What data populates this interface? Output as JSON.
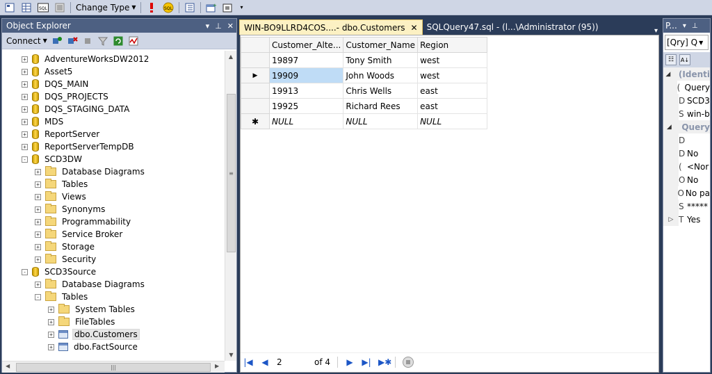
{
  "toolbar": {
    "change_type_label": "Change Type"
  },
  "object_explorer": {
    "title": "Object Explorer",
    "connect_label": "Connect",
    "tree": [
      {
        "label": "AdventureWorksDW2012",
        "level": 0,
        "icon": "database-icon",
        "expander": "+"
      },
      {
        "label": "Asset5",
        "level": 0,
        "icon": "database-icon",
        "expander": "+"
      },
      {
        "label": "DQS_MAIN",
        "level": 0,
        "icon": "database-icon",
        "expander": "+"
      },
      {
        "label": "DQS_PROJECTS",
        "level": 0,
        "icon": "database-icon",
        "expander": "+"
      },
      {
        "label": "DQS_STAGING_DATA",
        "level": 0,
        "icon": "database-icon",
        "expander": "+"
      },
      {
        "label": "MDS",
        "level": 0,
        "icon": "database-icon",
        "expander": "+"
      },
      {
        "label": "ReportServer",
        "level": 0,
        "icon": "database-icon",
        "expander": "+"
      },
      {
        "label": "ReportServerTempDB",
        "level": 0,
        "icon": "database-icon",
        "expander": "+"
      },
      {
        "label": "SCD3DW",
        "level": 0,
        "icon": "database-icon",
        "expander": "-"
      },
      {
        "label": "Database Diagrams",
        "level": 1,
        "icon": "folder-icon",
        "expander": "+"
      },
      {
        "label": "Tables",
        "level": 1,
        "icon": "folder-icon",
        "expander": "+"
      },
      {
        "label": "Views",
        "level": 1,
        "icon": "folder-icon",
        "expander": "+"
      },
      {
        "label": "Synonyms",
        "level": 1,
        "icon": "folder-icon",
        "expander": "+"
      },
      {
        "label": "Programmability",
        "level": 1,
        "icon": "folder-icon",
        "expander": "+"
      },
      {
        "label": "Service Broker",
        "level": 1,
        "icon": "folder-icon",
        "expander": "+"
      },
      {
        "label": "Storage",
        "level": 1,
        "icon": "folder-icon",
        "expander": "+"
      },
      {
        "label": "Security",
        "level": 1,
        "icon": "folder-icon",
        "expander": "+"
      },
      {
        "label": "SCD3Source",
        "level": 0,
        "icon": "database-icon",
        "expander": "-"
      },
      {
        "label": "Database Diagrams",
        "level": 1,
        "icon": "folder-icon",
        "expander": "+"
      },
      {
        "label": "Tables",
        "level": 1,
        "icon": "folder-icon",
        "expander": "-"
      },
      {
        "label": "System Tables",
        "level": 2,
        "icon": "folder-icon",
        "expander": "+"
      },
      {
        "label": "FileTables",
        "level": 2,
        "icon": "folder-icon",
        "expander": "+"
      },
      {
        "label": "dbo.Customers",
        "level": 2,
        "icon": "table-icon",
        "expander": "+",
        "selected": true
      },
      {
        "label": "dbo.FactSource",
        "level": 2,
        "icon": "table-icon",
        "expander": "+"
      }
    ]
  },
  "tabs": [
    {
      "label": "WIN-BO9LLRD4COS....- dbo.Customers",
      "active": true
    },
    {
      "label": "SQLQuery47.sql - (l...\\Administrator (95))",
      "active": false
    }
  ],
  "grid": {
    "columns": [
      "Customer_Alte...",
      "Customer_Name",
      "Region"
    ],
    "rows": [
      {
        "marker": "",
        "cells": [
          "19897",
          "Tony Smith",
          "west"
        ]
      },
      {
        "marker": "▶",
        "cells": [
          "19909",
          "John Woods",
          "west"
        ],
        "selected_col": 0
      },
      {
        "marker": "",
        "cells": [
          "19913",
          "Chris Wells",
          "east"
        ]
      },
      {
        "marker": "",
        "cells": [
          "19925",
          "Richard Rees",
          "east"
        ]
      },
      {
        "marker": "✱",
        "cells": [
          "NULL",
          "NULL",
          "NULL"
        ],
        "null_row": true
      }
    ]
  },
  "navigator": {
    "current": "2",
    "of_label": "of 4"
  },
  "properties": {
    "title": "P...",
    "object": "[Qry] Q",
    "rows": [
      {
        "gut": "◢",
        "name": "",
        "value": "(Identi",
        "cat": true
      },
      {
        "gut": "",
        "name": "(",
        "value": "Query",
        "cat": false
      },
      {
        "gut": "",
        "name": "D",
        "value": "SCD3",
        "cat": false
      },
      {
        "gut": "",
        "name": "S",
        "value": "win-b",
        "cat": false
      },
      {
        "gut": "◢",
        "name": "",
        "value": "Query",
        "cat": true
      },
      {
        "gut": "",
        "name": "D",
        "value": "",
        "cat": false
      },
      {
        "gut": "",
        "name": "D",
        "value": "No",
        "cat": false
      },
      {
        "gut": "",
        "name": "(",
        "value": "<Nor",
        "cat": false
      },
      {
        "gut": "",
        "name": "O",
        "value": "No",
        "cat": false
      },
      {
        "gut": "",
        "name": "O",
        "value": "No pa",
        "cat": false
      },
      {
        "gut": "",
        "name": "S",
        "value": "*****",
        "cat": false
      },
      {
        "gut": "▷",
        "name": "T",
        "value": "Yes",
        "cat": false
      }
    ]
  }
}
